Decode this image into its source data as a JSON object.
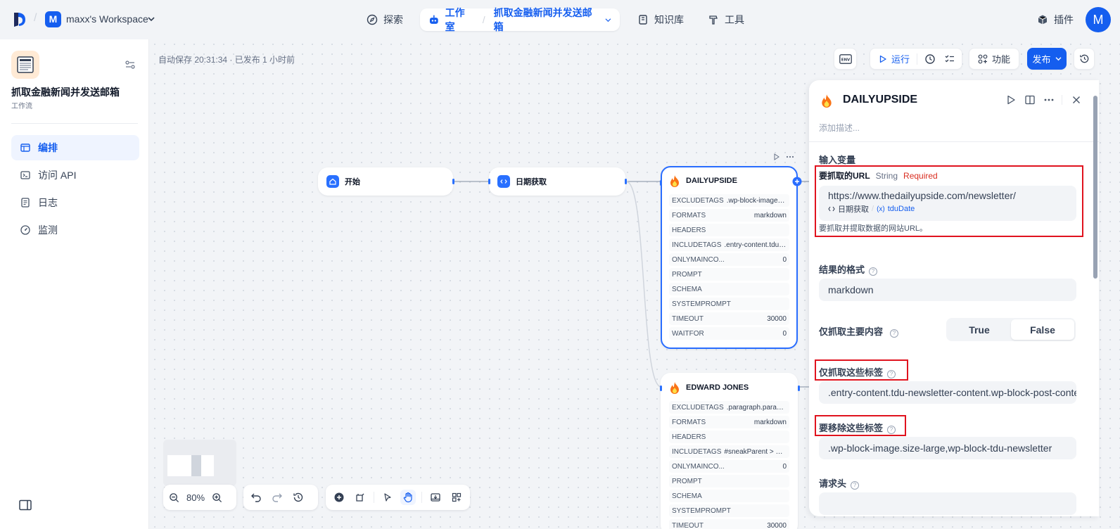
{
  "topbar": {
    "workspace_initial": "M",
    "workspace_name": "maxx's Workspace",
    "nav_explore": "探索",
    "nav_studio": "工作室",
    "nav_app": "抓取金融新闻并发送邮箱",
    "nav_knowledge": "知识库",
    "nav_tools": "工具",
    "plugins": "插件",
    "user_initial": "M"
  },
  "sidebar": {
    "app_title": "抓取金融新闻并发送邮箱",
    "app_type": "工作流",
    "items": [
      {
        "label": "编排",
        "icon": "layout-icon",
        "active": true
      },
      {
        "label": "访问 API",
        "icon": "terminal-icon",
        "active": false
      },
      {
        "label": "日志",
        "icon": "log-icon",
        "active": false
      },
      {
        "label": "监测",
        "icon": "gauge-icon",
        "active": false
      }
    ]
  },
  "canvas": {
    "autosave": "自动保存 20:31:34 · 已发布 1 小时前",
    "toolbar": {
      "env": "ENV",
      "run": "运行",
      "features": "功能",
      "publish": "发布"
    },
    "zoom": "80%",
    "nodes": {
      "start": {
        "title": "开始"
      },
      "date": {
        "title": "日期获取"
      },
      "dailyupside": {
        "title": "DAILYUPSIDE",
        "props": [
          {
            "k": "EXCLUDETAGS",
            "v": ".wp-block-image.si..."
          },
          {
            "k": "FORMATS",
            "v": "markdown"
          },
          {
            "k": "HEADERS",
            "v": ""
          },
          {
            "k": "INCLUDETAGS",
            "v": ".entry-content.tdu-..."
          },
          {
            "k": "ONLYMAINCO...",
            "v": "0"
          },
          {
            "k": "PROMPT",
            "v": ""
          },
          {
            "k": "SCHEMA",
            "v": ""
          },
          {
            "k": "SYSTEMPROMPT",
            "v": ""
          },
          {
            "k": "TIMEOUT",
            "v": "30000"
          },
          {
            "k": "WAITFOR",
            "v": "0"
          }
        ]
      },
      "edwardjones": {
        "title": "EDWARD JONES",
        "props": [
          {
            "k": "EXCLUDETAGS",
            "v": ".paragraph.paragr..."
          },
          {
            "k": "FORMATS",
            "v": "markdown"
          },
          {
            "k": "HEADERS",
            "v": ""
          },
          {
            "k": "INCLUDETAGS",
            "v": "#sneakParent > div..."
          },
          {
            "k": "ONLYMAINCO...",
            "v": "0"
          },
          {
            "k": "PROMPT",
            "v": ""
          },
          {
            "k": "SCHEMA",
            "v": ""
          },
          {
            "k": "SYSTEMPROMPT",
            "v": ""
          },
          {
            "k": "TIMEOUT",
            "v": "30000"
          }
        ]
      }
    }
  },
  "panel": {
    "title": "DAILYUPSIDE",
    "desc_placeholder": "添加描述...",
    "input_vars": "输入变量",
    "url_label": "要抓取的URL",
    "url_type": "String",
    "url_required": "Required",
    "url_value": "https://www.thedailyupside.com/newsletter/",
    "url_ref_node": "日期获取",
    "url_ref_var": "tduDate",
    "url_hint": "要抓取并提取数据的网站URL。",
    "format_label": "结果的格式",
    "format_value": "markdown",
    "main_only_label": "仅抓取主要内容",
    "true_label": "True",
    "false_label": "False",
    "include_label": "仅抓取这些标签",
    "include_value": ".entry-content.tdu-newsletter-content.wp-block-post-content",
    "exclude_label": "要移除这些标签",
    "exclude_value": ".wp-block-image.size-large,wp-block-tdu-newsletter",
    "headers_label": "请求头",
    "headers_value": ""
  },
  "colors": {
    "accent": "#155eef",
    "highlight": "#e0131e",
    "required": "#d92d20"
  }
}
